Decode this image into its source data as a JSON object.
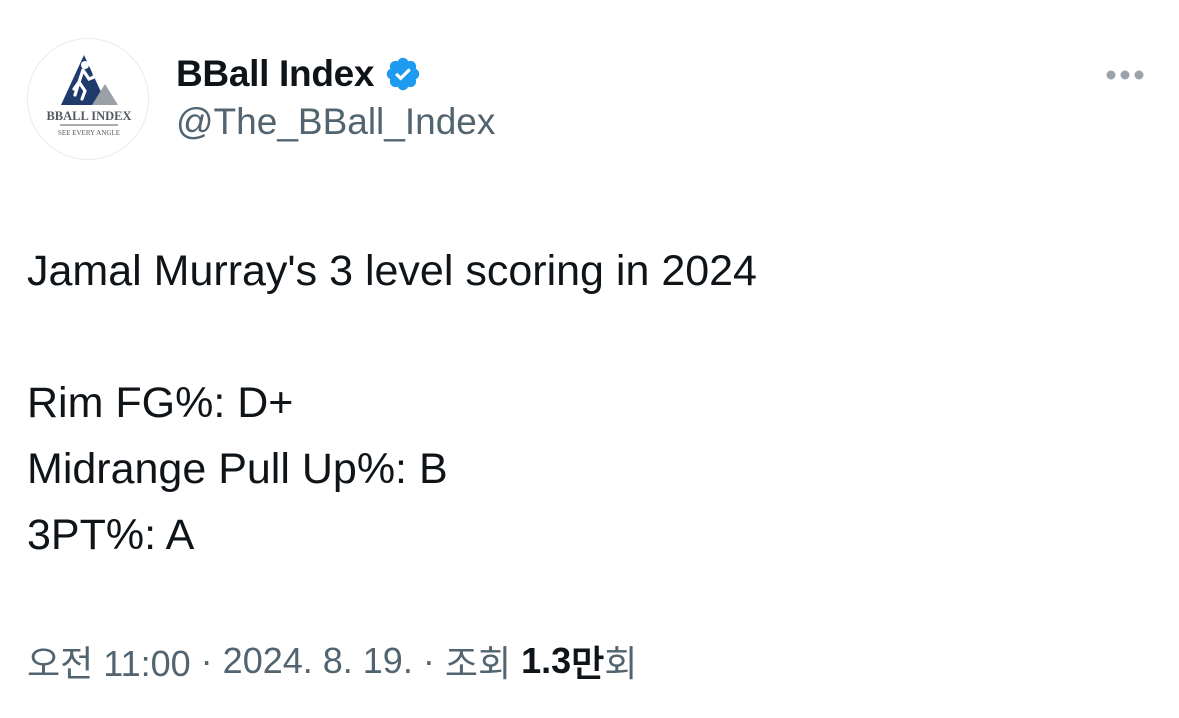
{
  "author": {
    "display_name": "BBall Index",
    "handle": "@The_BBall_Index",
    "verified": true,
    "avatar_logo_text": "BBALL INDEX",
    "avatar_tagline": "SEE EVERY ANGLE"
  },
  "tweet": {
    "line1": "Jamal Murray's 3 level scoring in 2024",
    "line2": "Rim FG%: D+",
    "line3": "Midrange Pull Up%: B",
    "line4": "3PT%: A"
  },
  "meta": {
    "time": "오전 11:00",
    "separator1": "·",
    "date": "2024. 8. 19.",
    "separator2": "·",
    "views_label": "조회",
    "views_count": "1.3",
    "views_unit": "만",
    "views_suffix": "회"
  },
  "colors": {
    "text_primary": "#0f1419",
    "text_secondary": "#536471",
    "verified_blue": "#1d9bf0",
    "logo_navy": "#1f3a6b",
    "logo_gray": "#9aa0a6"
  },
  "icons": {
    "verified": "verified-badge-icon",
    "more": "more-horizontal-icon"
  }
}
